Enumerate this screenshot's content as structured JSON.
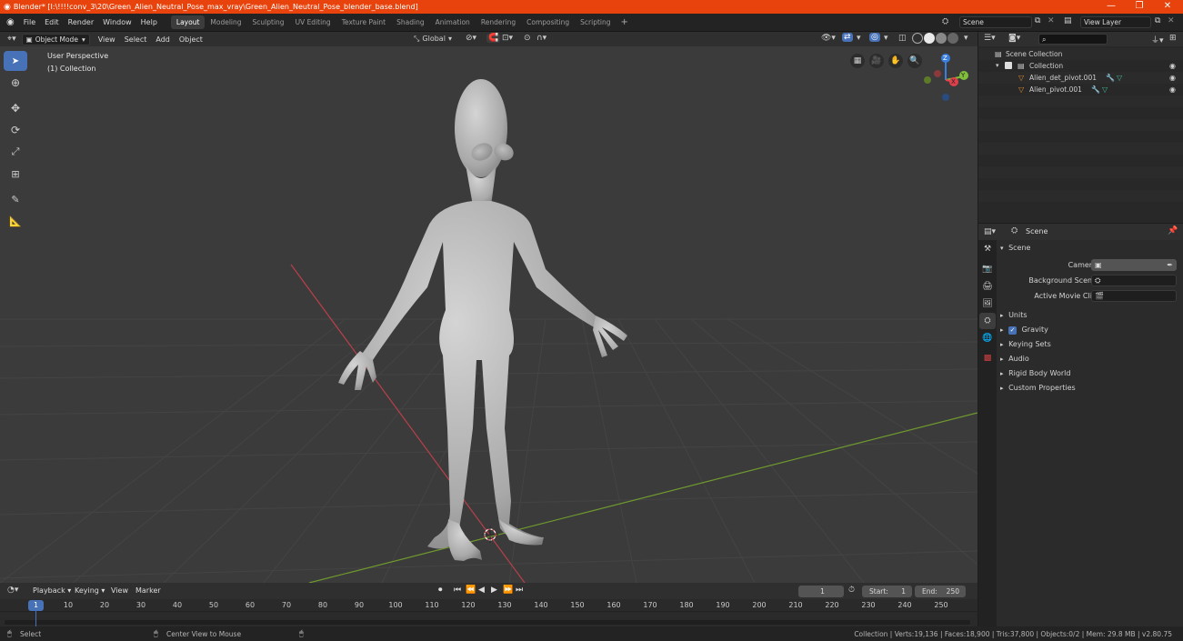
{
  "window": {
    "title": "Blender* [I:\\!!!!conv_3\\20\\Green_Alien_Neutral_Pose_max_vray\\Green_Alien_Neutral_Pose_blender_base.blend]",
    "minimize": "—",
    "restore": "❐",
    "close": "✕"
  },
  "menu": [
    "File",
    "Edit",
    "Render",
    "Window",
    "Help"
  ],
  "workspaces": [
    "Layout",
    "Modeling",
    "Sculpting",
    "UV Editing",
    "Texture Paint",
    "Shading",
    "Animation",
    "Rendering",
    "Compositing",
    "Scripting"
  ],
  "active_workspace": "Layout",
  "scene_field": "Scene",
  "view_layer_field": "View Layer",
  "viewport_header": {
    "mode": "Object Mode",
    "menus": [
      "View",
      "Select",
      "Add",
      "Object"
    ],
    "orientation": "Global"
  },
  "viewport": {
    "perspective": "User Perspective",
    "collection": "(1) Collection"
  },
  "gizmo": {
    "x": "X",
    "y": "Y",
    "z": "Z"
  },
  "outliner": {
    "search_placeholder": "",
    "scene_collection": "Scene Collection",
    "collection": "Collection",
    "objects": [
      "Alien_det_pivot.001",
      "Alien_pivot.001"
    ]
  },
  "properties": {
    "context": "Scene",
    "panel_title": "Scene",
    "camera_label": "Camera",
    "background_scene_label": "Background Scene",
    "active_clip_label": "Active Movie Clip",
    "sections": [
      "Units",
      "Gravity",
      "Keying Sets",
      "Audio",
      "Rigid Body World",
      "Custom Properties"
    ],
    "gravity_checked": true
  },
  "timeline": {
    "menus": [
      "Playback",
      "Keying",
      "View",
      "Marker"
    ],
    "current_frame": "1",
    "start_label": "Start:",
    "start": "1",
    "end_label": "End:",
    "end": "250",
    "ruler_current": "1",
    "ruler_ticks": [
      "10",
      "20",
      "30",
      "40",
      "50",
      "60",
      "70",
      "80",
      "90",
      "100",
      "110",
      "120",
      "130",
      "140",
      "150",
      "160",
      "170",
      "180",
      "190",
      "200",
      "210",
      "220",
      "230",
      "240",
      "250"
    ]
  },
  "statusbar": {
    "select": "Select",
    "center_view": "Center View to Mouse",
    "stats": "Collection | Verts:19,136 | Faces:18,900 | Tris:37,800 | Objects:0/2 | Mem: 29.8 MB | v2.80.75"
  },
  "colors": {
    "title_bar": "#e8430c",
    "active_tool": "#4872b8",
    "x_axis": "#e0404a",
    "y_axis": "#7fbf3a",
    "z_axis": "#3a7fe0"
  }
}
